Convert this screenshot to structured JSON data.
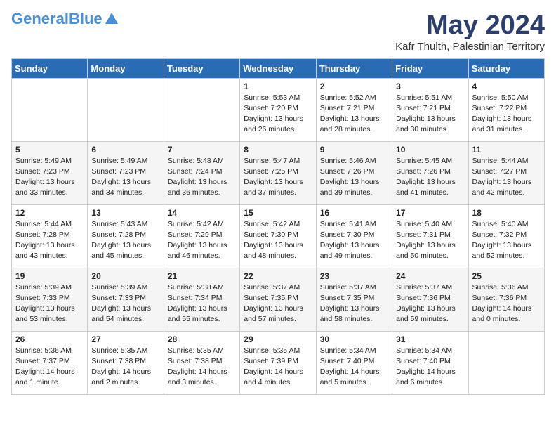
{
  "header": {
    "logo_general": "General",
    "logo_blue": "Blue",
    "month_title": "May 2024",
    "subtitle": "Kafr Thulth, Palestinian Territory"
  },
  "days_of_week": [
    "Sunday",
    "Monday",
    "Tuesday",
    "Wednesday",
    "Thursday",
    "Friday",
    "Saturday"
  ],
  "weeks": [
    [
      {
        "day": "",
        "info": ""
      },
      {
        "day": "",
        "info": ""
      },
      {
        "day": "",
        "info": ""
      },
      {
        "day": "1",
        "info": "Sunrise: 5:53 AM\nSunset: 7:20 PM\nDaylight: 13 hours\nand 26 minutes."
      },
      {
        "day": "2",
        "info": "Sunrise: 5:52 AM\nSunset: 7:21 PM\nDaylight: 13 hours\nand 28 minutes."
      },
      {
        "day": "3",
        "info": "Sunrise: 5:51 AM\nSunset: 7:21 PM\nDaylight: 13 hours\nand 30 minutes."
      },
      {
        "day": "4",
        "info": "Sunrise: 5:50 AM\nSunset: 7:22 PM\nDaylight: 13 hours\nand 31 minutes."
      }
    ],
    [
      {
        "day": "5",
        "info": "Sunrise: 5:49 AM\nSunset: 7:23 PM\nDaylight: 13 hours\nand 33 minutes."
      },
      {
        "day": "6",
        "info": "Sunrise: 5:49 AM\nSunset: 7:23 PM\nDaylight: 13 hours\nand 34 minutes."
      },
      {
        "day": "7",
        "info": "Sunrise: 5:48 AM\nSunset: 7:24 PM\nDaylight: 13 hours\nand 36 minutes."
      },
      {
        "day": "8",
        "info": "Sunrise: 5:47 AM\nSunset: 7:25 PM\nDaylight: 13 hours\nand 37 minutes."
      },
      {
        "day": "9",
        "info": "Sunrise: 5:46 AM\nSunset: 7:26 PM\nDaylight: 13 hours\nand 39 minutes."
      },
      {
        "day": "10",
        "info": "Sunrise: 5:45 AM\nSunset: 7:26 PM\nDaylight: 13 hours\nand 41 minutes."
      },
      {
        "day": "11",
        "info": "Sunrise: 5:44 AM\nSunset: 7:27 PM\nDaylight: 13 hours\nand 42 minutes."
      }
    ],
    [
      {
        "day": "12",
        "info": "Sunrise: 5:44 AM\nSunset: 7:28 PM\nDaylight: 13 hours\nand 43 minutes."
      },
      {
        "day": "13",
        "info": "Sunrise: 5:43 AM\nSunset: 7:28 PM\nDaylight: 13 hours\nand 45 minutes."
      },
      {
        "day": "14",
        "info": "Sunrise: 5:42 AM\nSunset: 7:29 PM\nDaylight: 13 hours\nand 46 minutes."
      },
      {
        "day": "15",
        "info": "Sunrise: 5:42 AM\nSunset: 7:30 PM\nDaylight: 13 hours\nand 48 minutes."
      },
      {
        "day": "16",
        "info": "Sunrise: 5:41 AM\nSunset: 7:30 PM\nDaylight: 13 hours\nand 49 minutes."
      },
      {
        "day": "17",
        "info": "Sunrise: 5:40 AM\nSunset: 7:31 PM\nDaylight: 13 hours\nand 50 minutes."
      },
      {
        "day": "18",
        "info": "Sunrise: 5:40 AM\nSunset: 7:32 PM\nDaylight: 13 hours\nand 52 minutes."
      }
    ],
    [
      {
        "day": "19",
        "info": "Sunrise: 5:39 AM\nSunset: 7:33 PM\nDaylight: 13 hours\nand 53 minutes."
      },
      {
        "day": "20",
        "info": "Sunrise: 5:39 AM\nSunset: 7:33 PM\nDaylight: 13 hours\nand 54 minutes."
      },
      {
        "day": "21",
        "info": "Sunrise: 5:38 AM\nSunset: 7:34 PM\nDaylight: 13 hours\nand 55 minutes."
      },
      {
        "day": "22",
        "info": "Sunrise: 5:37 AM\nSunset: 7:35 PM\nDaylight: 13 hours\nand 57 minutes."
      },
      {
        "day": "23",
        "info": "Sunrise: 5:37 AM\nSunset: 7:35 PM\nDaylight: 13 hours\nand 58 minutes."
      },
      {
        "day": "24",
        "info": "Sunrise: 5:37 AM\nSunset: 7:36 PM\nDaylight: 13 hours\nand 59 minutes."
      },
      {
        "day": "25",
        "info": "Sunrise: 5:36 AM\nSunset: 7:36 PM\nDaylight: 14 hours\nand 0 minutes."
      }
    ],
    [
      {
        "day": "26",
        "info": "Sunrise: 5:36 AM\nSunset: 7:37 PM\nDaylight: 14 hours\nand 1 minute."
      },
      {
        "day": "27",
        "info": "Sunrise: 5:35 AM\nSunset: 7:38 PM\nDaylight: 14 hours\nand 2 minutes."
      },
      {
        "day": "28",
        "info": "Sunrise: 5:35 AM\nSunset: 7:38 PM\nDaylight: 14 hours\nand 3 minutes."
      },
      {
        "day": "29",
        "info": "Sunrise: 5:35 AM\nSunset: 7:39 PM\nDaylight: 14 hours\nand 4 minutes."
      },
      {
        "day": "30",
        "info": "Sunrise: 5:34 AM\nSunset: 7:40 PM\nDaylight: 14 hours\nand 5 minutes."
      },
      {
        "day": "31",
        "info": "Sunrise: 5:34 AM\nSunset: 7:40 PM\nDaylight: 14 hours\nand 6 minutes."
      },
      {
        "day": "",
        "info": ""
      }
    ]
  ]
}
